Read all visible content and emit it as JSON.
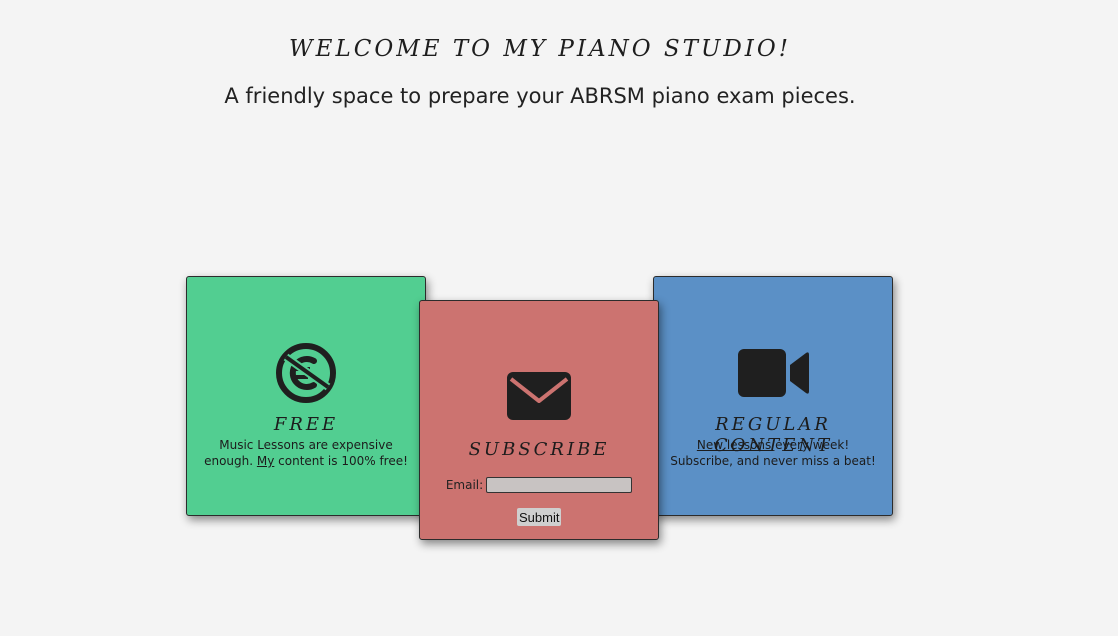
{
  "header": {
    "title": "WELCOME TO MY PIANO STUDIO!",
    "subtitle": "A friendly space to prepare your ABRSM piano exam pieces."
  },
  "cards": {
    "free": {
      "icon": "no-euro-icon",
      "title": "FREE",
      "line1": "Music Lessons are expensive",
      "line2_pre": "enough. ",
      "line2_link": "My",
      "line2_post": " content is 100% free!",
      "color": "#52ce91"
    },
    "subscribe": {
      "icon": "envelope-icon",
      "title": "SUBSCRIBE",
      "email_label": "Email:",
      "email_value": "",
      "submit_label": "Submit",
      "color": "#cc7370"
    },
    "regular": {
      "icon": "video-camera-icon",
      "title": "REGULAR CONTENT",
      "line1_link": "New lessons",
      "line1_post": " every week!",
      "line2": "Subscribe, and never miss a beat!",
      "color": "#5b90c6"
    }
  },
  "colors": {
    "background": "#f4f4f4",
    "text": "#222222"
  }
}
